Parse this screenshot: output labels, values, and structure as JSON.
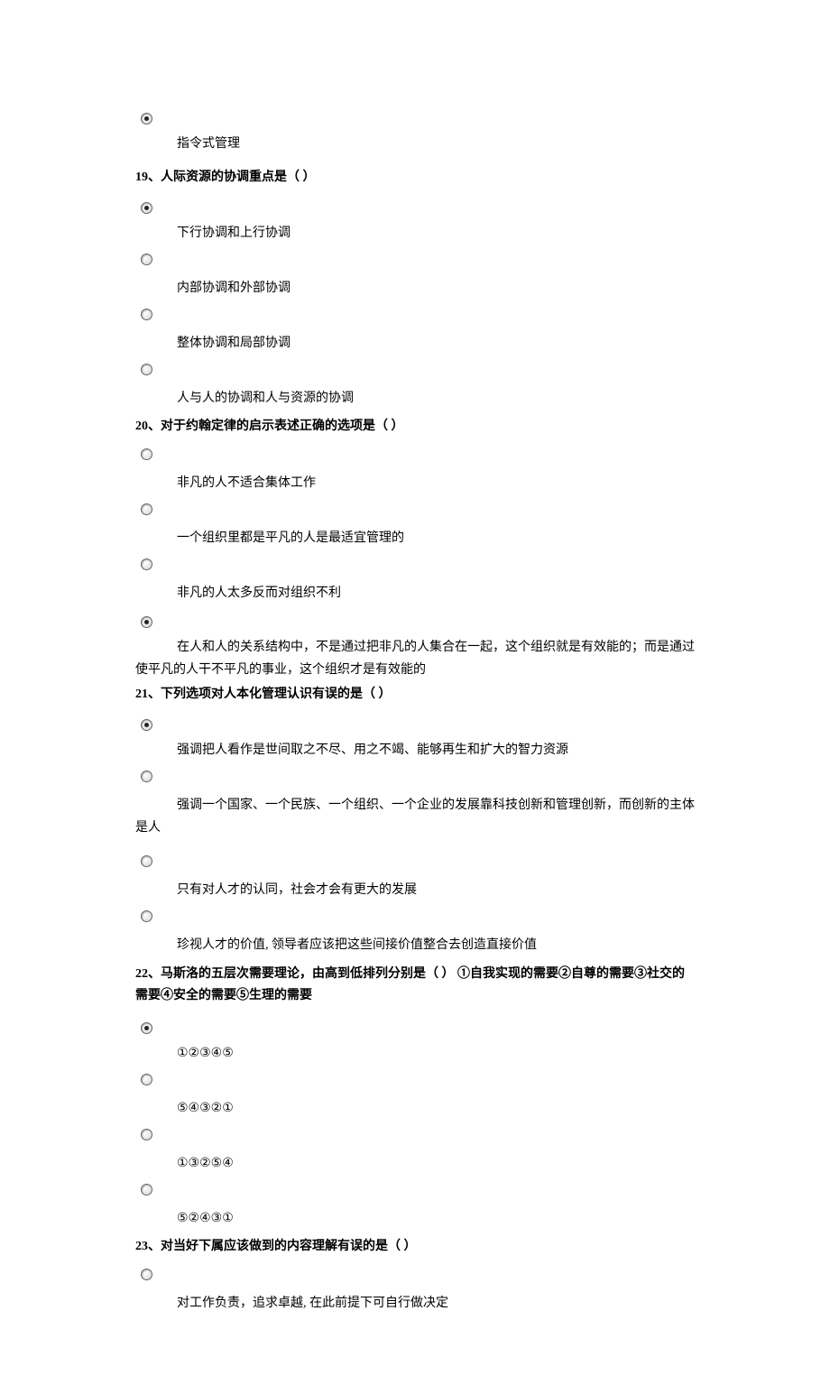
{
  "q18": {
    "opt1": "指令式管理"
  },
  "q19": {
    "stem": "19、人际资源的协调重点是（ ）",
    "opt1": "下行协调和上行协调",
    "opt2": "内部协调和外部协调",
    "opt3": "整体协调和局部协调",
    "opt4": "人与人的协调和人与资源的协调"
  },
  "q20": {
    "stem": "20、对于约翰定律的启示表述正确的选项是（ ）",
    "opt1": "非凡的人不适合集体工作",
    "opt2": "一个组织里都是平凡的人是最适宜管理的",
    "opt3": "非凡的人太多反而对组织不利",
    "opt4a": "在人和人的关系结构中，不是通过把非凡的人集合在一起，这个组织就是有效能的；而是通过",
    "opt4b": "使平凡的人干不平凡的事业，这个组织才是有效能的"
  },
  "q21": {
    "stem": "21、下列选项对人本化管理认识有误的是（ ）",
    "opt1": "强调把人看作是世间取之不尽、用之不竭、能够再生和扩大的智力资源",
    "opt2a": "强调一个国家、一个民族、一个组织、一个企业的发展靠科技创新和管理创新，而创新的主体",
    "opt2b": "是人",
    "opt3": "只有对人才的认同，社会才会有更大的发展",
    "opt4": "珍视人才的价值, 领导者应该把这些间接价值整合去创造直接价值"
  },
  "q22": {
    "stem": "22、马斯洛的五层次需要理论，由高到低排列分别是（ ） ①自我实现的需要②自尊的需要③社交的需要④安全的需要⑤生理的需要",
    "opt1": "①②③④⑤",
    "opt2": "⑤④③②①",
    "opt3": "①③②⑤④",
    "opt4": "⑤②④③①"
  },
  "q23": {
    "stem": "23、对当好下属应该做到的内容理解有误的是（ ）",
    "opt1": "对工作负责，追求卓越, 在此前提下可自行做决定"
  }
}
